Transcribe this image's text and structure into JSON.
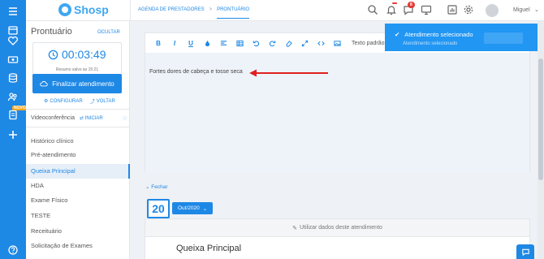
{
  "app": {
    "logo_text": "Shosp",
    "brand_color": "#1e88e5"
  },
  "rail": {
    "icons": [
      "menu-icon",
      "calendar-icon",
      "heart-icon",
      "money-icon",
      "database-icon",
      "doctors-icon",
      "clipboard-icon",
      "plus-icon",
      "help-icon"
    ],
    "novo_badge": "NOVO"
  },
  "header": {
    "breadcrumbs": [
      "AGENDA DE PRESTADORES",
      "PRONTUÁRIO"
    ],
    "separator": ">",
    "notification_badge": "",
    "chat_badge": "8",
    "user_name": "Miguel"
  },
  "panel": {
    "title": "Prontuário",
    "ocultar": "OCULTAR",
    "timer": "00:03:49",
    "timer_sub": "Resumo salvo às 15:21",
    "finalizar": "Finalizar atendimento",
    "configurar": "CONFIGURAR",
    "voltar": "VOLTAR",
    "videoconferencia": "Videoconferência",
    "iniciar": "INICIAR",
    "historico_title": "Histórico clínico",
    "nav_items": [
      {
        "label": "Pré-atendimento",
        "active": false
      },
      {
        "label": "Queixa Principal",
        "active": true
      },
      {
        "label": "HDA",
        "active": false
      },
      {
        "label": "Exame Físico",
        "active": false
      },
      {
        "label": "TESTE",
        "active": false
      },
      {
        "label": "Receituário",
        "active": false
      },
      {
        "label": "Solicitação de Exames",
        "active": false
      }
    ]
  },
  "editor": {
    "toolbar": [
      "B",
      "I",
      "U"
    ],
    "text_label": "Texto padrão",
    "content": "Fortes dores de cabeça e tosse seca"
  },
  "timeline": {
    "fechar": "Fechar",
    "day": "20",
    "month": "Out/2020",
    "utilizar": "Utilizar dados deste atendimento",
    "section_title": "Queixa Principal"
  },
  "toast": {
    "title": "Atendimento selecionado",
    "subtitle": "Atendimento selecionado"
  }
}
